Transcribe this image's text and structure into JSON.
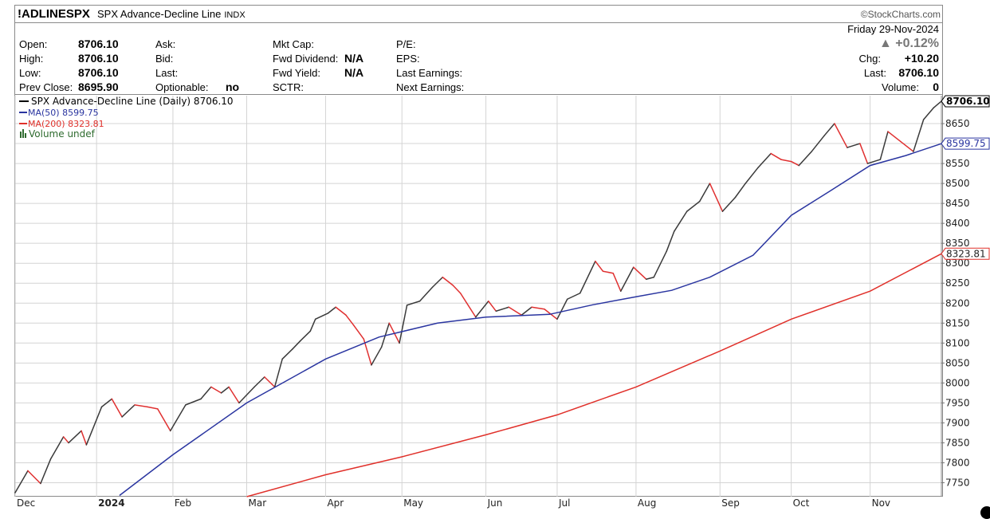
{
  "header": {
    "symbol": "!ADLINESPX",
    "description": "SPX Advance-Decline Line",
    "exchange": "INDX",
    "brand": "©StockCharts.com"
  },
  "quote": {
    "open_label": "Open:",
    "open": "8706.10",
    "high_label": "High:",
    "high": "8706.10",
    "low_label": "Low:",
    "low": "8706.10",
    "prev_close_label": "Prev Close:",
    "prev_close": "8695.90",
    "ask_label": "Ask:",
    "bid_label": "Bid:",
    "last_label_mid": "Last:",
    "optionable_label": "Optionable:",
    "optionable": "no",
    "mkt_cap_label": "Mkt Cap:",
    "fwd_dividend_label": "Fwd Dividend:",
    "fwd_dividend": "N/A",
    "fwd_yield_label": "Fwd Yield:",
    "fwd_yield": "N/A",
    "sctr_label": "SCTR:",
    "pe_label": "P/E:",
    "eps_label": "EPS:",
    "last_earnings_label": "Last Earnings:",
    "next_earnings_label": "Next Earnings:",
    "date": "Friday  29-Nov-2024",
    "change_pct": "▲ +0.12%",
    "chg_label": "Chg:",
    "chg": "+10.20",
    "last_label": "Last:",
    "last": "8706.10",
    "volume_label": "Volume:",
    "volume": "0"
  },
  "legend": {
    "line1": "SPX Advance-Decline Line (Daily) 8706.10",
    "line2": "MA(50) 8599.75",
    "line3": "MA(200) 8323.81",
    "line4": "Volume undef"
  },
  "colors": {
    "price_up": "#3a3a3a",
    "price_down": "#e03030",
    "ma50": "#2a35a0",
    "ma200": "#e0302a",
    "volume": "#2e6b2e",
    "grid": "#d4d4d4"
  },
  "chart_data": {
    "type": "line",
    "title": "SPX Advance-Decline Line",
    "xlabel": "",
    "ylabel": "",
    "ylim": [
      7715,
      8720
    ],
    "yticks": [
      7750,
      7800,
      7850,
      7900,
      7950,
      8000,
      8050,
      8100,
      8150,
      8200,
      8250,
      8300,
      8350,
      8400,
      8450,
      8500,
      8550,
      8600,
      8650
    ],
    "x_labels": [
      "Dec",
      "2024",
      "Feb",
      "Mar",
      "Apr",
      "May",
      "Jun",
      "Jul",
      "Aug",
      "Sep",
      "Oct",
      "Nov"
    ],
    "x_label_dates": [
      "2023-12-01",
      "2024-01-02",
      "2024-02-01",
      "2024-03-01",
      "2024-04-01",
      "2024-05-01",
      "2024-06-03",
      "2024-07-01",
      "2024-08-01",
      "2024-09-03",
      "2024-10-01",
      "2024-11-01"
    ],
    "x_range": [
      "2023-12-01",
      "2024-11-29"
    ],
    "grid": true,
    "legend": "top-left",
    "value_labels": [
      {
        "series": "SPX Advance-Decline Line",
        "value": 8706.1,
        "text": "8706.10"
      },
      {
        "series": "MA(50)",
        "value": 8599.75,
        "text": "8599.75"
      },
      {
        "series": "MA(200)",
        "value": 8323.81,
        "text": "8323.81"
      }
    ],
    "series": [
      {
        "name": "SPX Advance-Decline Line",
        "points": [
          [
            "2023-12-01",
            7725
          ],
          [
            "2023-12-06",
            7780
          ],
          [
            "2023-12-11",
            7748
          ],
          [
            "2023-12-15",
            7810
          ],
          [
            "2023-12-20",
            7865
          ],
          [
            "2023-12-22",
            7850
          ],
          [
            "2023-12-27",
            7880
          ],
          [
            "2023-12-29",
            7845
          ],
          [
            "2024-01-04",
            7940
          ],
          [
            "2024-01-08",
            7960
          ],
          [
            "2024-01-12",
            7915
          ],
          [
            "2024-01-17",
            7945
          ],
          [
            "2024-01-22",
            7940
          ],
          [
            "2024-01-26",
            7935
          ],
          [
            "2024-01-31",
            7880
          ],
          [
            "2024-02-06",
            7945
          ],
          [
            "2024-02-12",
            7960
          ],
          [
            "2024-02-16",
            7990
          ],
          [
            "2024-02-20",
            7975
          ],
          [
            "2024-02-23",
            7990
          ],
          [
            "2024-02-27",
            7950
          ],
          [
            "2024-03-04",
            7990
          ],
          [
            "2024-03-08",
            8015
          ],
          [
            "2024-03-12",
            7990
          ],
          [
            "2024-03-15",
            8060
          ],
          [
            "2024-03-19",
            8085
          ],
          [
            "2024-03-22",
            8105
          ],
          [
            "2024-03-26",
            8130
          ],
          [
            "2024-03-28",
            8160
          ],
          [
            "2024-04-02",
            8175
          ],
          [
            "2024-04-05",
            8190
          ],
          [
            "2024-04-09",
            8170
          ],
          [
            "2024-04-12",
            8145
          ],
          [
            "2024-04-16",
            8110
          ],
          [
            "2024-04-19",
            8045
          ],
          [
            "2024-04-23",
            8090
          ],
          [
            "2024-04-26",
            8150
          ],
          [
            "2024-04-30",
            8100
          ],
          [
            "2024-05-03",
            8195
          ],
          [
            "2024-05-08",
            8205
          ],
          [
            "2024-05-13",
            8240
          ],
          [
            "2024-05-17",
            8265
          ],
          [
            "2024-05-21",
            8245
          ],
          [
            "2024-05-24",
            8225
          ],
          [
            "2024-05-30",
            8165
          ],
          [
            "2024-06-04",
            8205
          ],
          [
            "2024-06-07",
            8180
          ],
          [
            "2024-06-12",
            8190
          ],
          [
            "2024-06-17",
            8170
          ],
          [
            "2024-06-21",
            8190
          ],
          [
            "2024-06-26",
            8185
          ],
          [
            "2024-07-01",
            8160
          ],
          [
            "2024-07-05",
            8210
          ],
          [
            "2024-07-10",
            8225
          ],
          [
            "2024-07-16",
            8305
          ],
          [
            "2024-07-19",
            8280
          ],
          [
            "2024-07-23",
            8275
          ],
          [
            "2024-07-26",
            8230
          ],
          [
            "2024-07-31",
            8290
          ],
          [
            "2024-08-05",
            8260
          ],
          [
            "2024-08-08",
            8265
          ],
          [
            "2024-08-13",
            8330
          ],
          [
            "2024-08-16",
            8380
          ],
          [
            "2024-08-21",
            8430
          ],
          [
            "2024-08-26",
            8455
          ],
          [
            "2024-08-30",
            8500
          ],
          [
            "2024-09-04",
            8430
          ],
          [
            "2024-09-09",
            8465
          ],
          [
            "2024-09-13",
            8500
          ],
          [
            "2024-09-18",
            8540
          ],
          [
            "2024-09-23",
            8575
          ],
          [
            "2024-09-27",
            8560
          ],
          [
            "2024-10-01",
            8555
          ],
          [
            "2024-10-04",
            8545
          ],
          [
            "2024-10-09",
            8580
          ],
          [
            "2024-10-14",
            8620
          ],
          [
            "2024-10-18",
            8650
          ],
          [
            "2024-10-23",
            8590
          ],
          [
            "2024-10-28",
            8600
          ],
          [
            "2024-10-31",
            8550
          ],
          [
            "2024-11-05",
            8560
          ],
          [
            "2024-11-08",
            8630
          ],
          [
            "2024-11-13",
            8605
          ],
          [
            "2024-11-18",
            8580
          ],
          [
            "2024-11-22",
            8660
          ],
          [
            "2024-11-26",
            8690
          ],
          [
            "2024-11-29",
            8706.1
          ]
        ]
      },
      {
        "name": "MA(50)",
        "points": [
          [
            "2024-01-11",
            7718
          ],
          [
            "2024-02-01",
            7820
          ],
          [
            "2024-03-01",
            7950
          ],
          [
            "2024-04-01",
            8060
          ],
          [
            "2024-04-22",
            8115
          ],
          [
            "2024-05-15",
            8150
          ],
          [
            "2024-06-03",
            8165
          ],
          [
            "2024-06-28",
            8172
          ],
          [
            "2024-07-15",
            8196
          ],
          [
            "2024-08-01",
            8216
          ],
          [
            "2024-08-15",
            8232
          ],
          [
            "2024-08-30",
            8265
          ],
          [
            "2024-09-16",
            8320
          ],
          [
            "2024-10-01",
            8420
          ],
          [
            "2024-10-16",
            8480
          ],
          [
            "2024-11-01",
            8545
          ],
          [
            "2024-11-15",
            8570
          ],
          [
            "2024-11-29",
            8599.75
          ]
        ]
      },
      {
        "name": "MA(200)",
        "points": [
          [
            "2024-03-01",
            7715
          ],
          [
            "2024-04-01",
            7770
          ],
          [
            "2024-05-01",
            7815
          ],
          [
            "2024-06-03",
            7870
          ],
          [
            "2024-07-01",
            7920
          ],
          [
            "2024-08-01",
            7990
          ],
          [
            "2024-09-03",
            8080
          ],
          [
            "2024-10-01",
            8160
          ],
          [
            "2024-11-01",
            8230
          ],
          [
            "2024-11-29",
            8323.81
          ]
        ]
      }
    ]
  }
}
